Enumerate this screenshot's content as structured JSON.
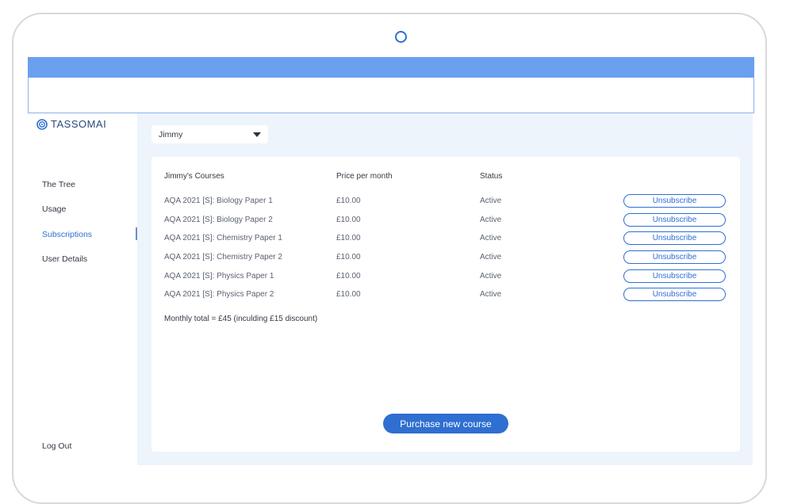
{
  "app": {
    "brand": "TASSOMAI"
  },
  "sidebar": {
    "items": [
      {
        "label": "The Tree"
      },
      {
        "label": "Usage"
      },
      {
        "label": "Subscriptions",
        "active": true
      },
      {
        "label": "User Details"
      }
    ],
    "logout_label": "Log Out"
  },
  "user_select": {
    "selected": "Jimmy"
  },
  "courses_table": {
    "headers": [
      "Jimmy's Courses",
      "Price per month",
      "Status"
    ],
    "rows": [
      {
        "course": "AQA 2021 [S]: Biology Paper 1",
        "price": "£10.00",
        "status": "Active",
        "action": "Unsubscribe"
      },
      {
        "course": "AQA 2021 [S]: Biology Paper 2",
        "price": "£10.00",
        "status": "Active",
        "action": "Unsubscribe"
      },
      {
        "course": "AQA 2021 [S]: Chemistry Paper 1",
        "price": "£10.00",
        "status": "Active",
        "action": "Unsubscribe"
      },
      {
        "course": "AQA 2021 [S]: Chemistry Paper 2",
        "price": "£10.00",
        "status": "Active",
        "action": "Unsubscribe"
      },
      {
        "course": "AQA 2021 [S]: Physics Paper 1",
        "price": "£10.00",
        "status": "Active",
        "action": "Unsubscribe"
      },
      {
        "course": "AQA 2021 [S]: Physics Paper 2",
        "price": "£10.00",
        "status": "Active",
        "action": "Unsubscribe"
      }
    ],
    "total": "Monthly total = £45 (inculding £15 discount)"
  },
  "purchase_button_label": "Purchase new course",
  "colors": {
    "accent": "#2f6fd1",
    "browser_bar": "#6b9ff0",
    "content_bg": "#eef4fc"
  },
  "icons": {
    "logo": "spiral-logo-icon",
    "dropdown": "caret-down-icon",
    "camera": "camera-icon"
  }
}
